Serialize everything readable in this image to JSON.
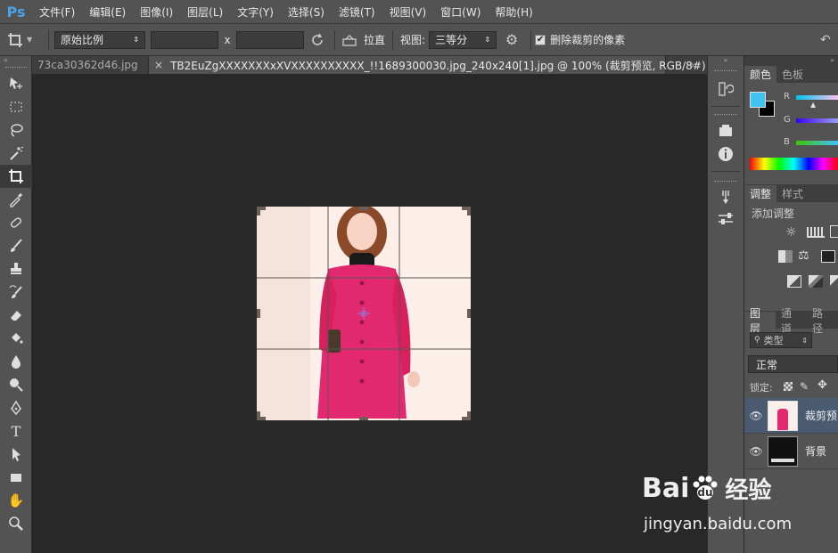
{
  "app": {
    "logo": "Ps"
  },
  "menu": [
    "文件(F)",
    "编辑(E)",
    "图像(I)",
    "图层(L)",
    "文字(Y)",
    "选择(S)",
    "滤镜(T)",
    "视图(V)",
    "窗口(W)",
    "帮助(H)"
  ],
  "options": {
    "ratio": "原始比例",
    "x_sep": "x",
    "straighten": "拉直",
    "view_label": "视图:",
    "view_value": "三等分",
    "delete_pixels": "删除裁剪的像素",
    "delete_pixels_checked": true
  },
  "tabs": [
    {
      "label": "73ca30362d46.jpg",
      "active": false
    },
    {
      "label": "TB2EuZgXXXXXXXxXVXXXXXXXXXX_!!1689300030.jpg_240x240[1].jpg @ 100% (裁剪预览, RGB/8#)",
      "active": true
    }
  ],
  "color_panel": {
    "tabs": [
      "颜色",
      "色板"
    ],
    "channels": [
      "R",
      "G",
      "B"
    ],
    "fg_color": "#3fc3f0",
    "bg_color": "#000000"
  },
  "adjust_panel": {
    "tabs": [
      "调整",
      "样式"
    ],
    "title": "添加调整"
  },
  "layers_panel": {
    "tabs": [
      "图层",
      "通道",
      "路径"
    ],
    "filter": "类型",
    "blend": "正常",
    "lock_label": "锁定:",
    "layers": [
      {
        "name": "裁剪预",
        "selected": true
      },
      {
        "name": "背景",
        "selected": false
      }
    ]
  },
  "watermark": {
    "brand": "Bai",
    "du": "du",
    "jingyan": "经验",
    "url": "jingyan.baidu.com"
  }
}
